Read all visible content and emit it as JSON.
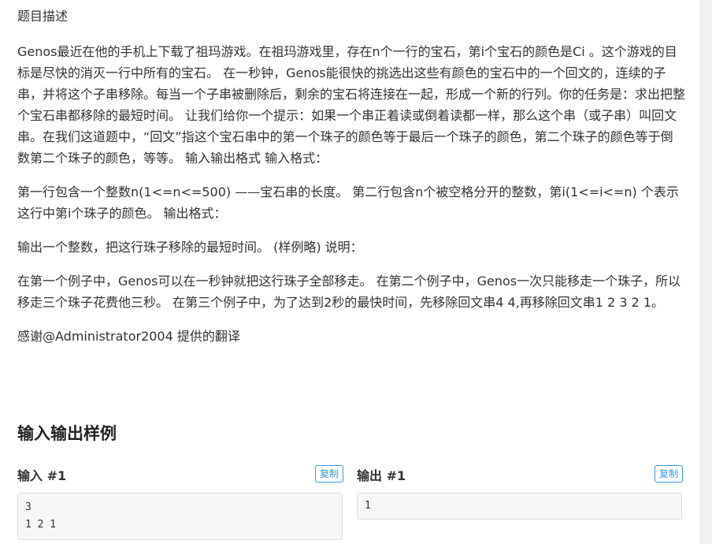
{
  "problem": {
    "description_heading": "题目描述",
    "paragraphs": [
      "Genos最近在他的手机上下载了祖玛游戏。在祖玛游戏里，存在n个一行的宝石，第i个宝石的颜色是Ci 。这个游戏的目标是尽快的消灭一行中所有的宝石。 在一秒钟，Genos能很快的挑选出这些有颜色的宝石中的一个回文的，连续的子串，并将这个子串移除。每当一个子串被删除后，剩余的宝石将连接在一起，形成一个新的行列。你的任务是：求出把整个宝石串都移除的最短时间。 让我们给你一个提示：如果一个串正着读或倒着读都一样，那么这个串（或子串）叫回文串。在我们这道题中，“回文”指这个宝石串中的第一个珠子的颜色等于最后一个珠子的颜色，第二个珠子的颜色等于倒数第二个珠子的颜色，等等。 输入输出格式 输入格式：",
      "第一行包含一个整数n(1<=n<=500) ——宝石串的长度。 第二行包含n个被空格分开的整数，第i(1<=i<=n) 个表示这行中第i个珠子的颜色。 输出格式：",
      "输出一个整数，把这行珠子移除的最短时间。 (样例略) 说明：",
      "在第一个例子中，Genos可以在一秒钟就把这行珠子全部移走。 在第二个例子中，Genos一次只能移走一个珠子，所以移走三个珠子花费他三秒。 在第三个例子中，为了达到2秒的最快时间，先移除回文串4 4,再移除回文串1 2 3 2 1。",
      "感谢@Administrator2004 提供的翻译"
    ]
  },
  "samples": {
    "title": "输入输出样例",
    "input": {
      "label": "输入 #1",
      "copy_label": "复制",
      "content": "3\n1 2 1"
    },
    "output": {
      "label": "输出 #1",
      "copy_label": "复制",
      "content": "1"
    }
  },
  "colors": {
    "accent": "#3498db",
    "text": "#333333",
    "code_bg": "#f6f6f6"
  }
}
